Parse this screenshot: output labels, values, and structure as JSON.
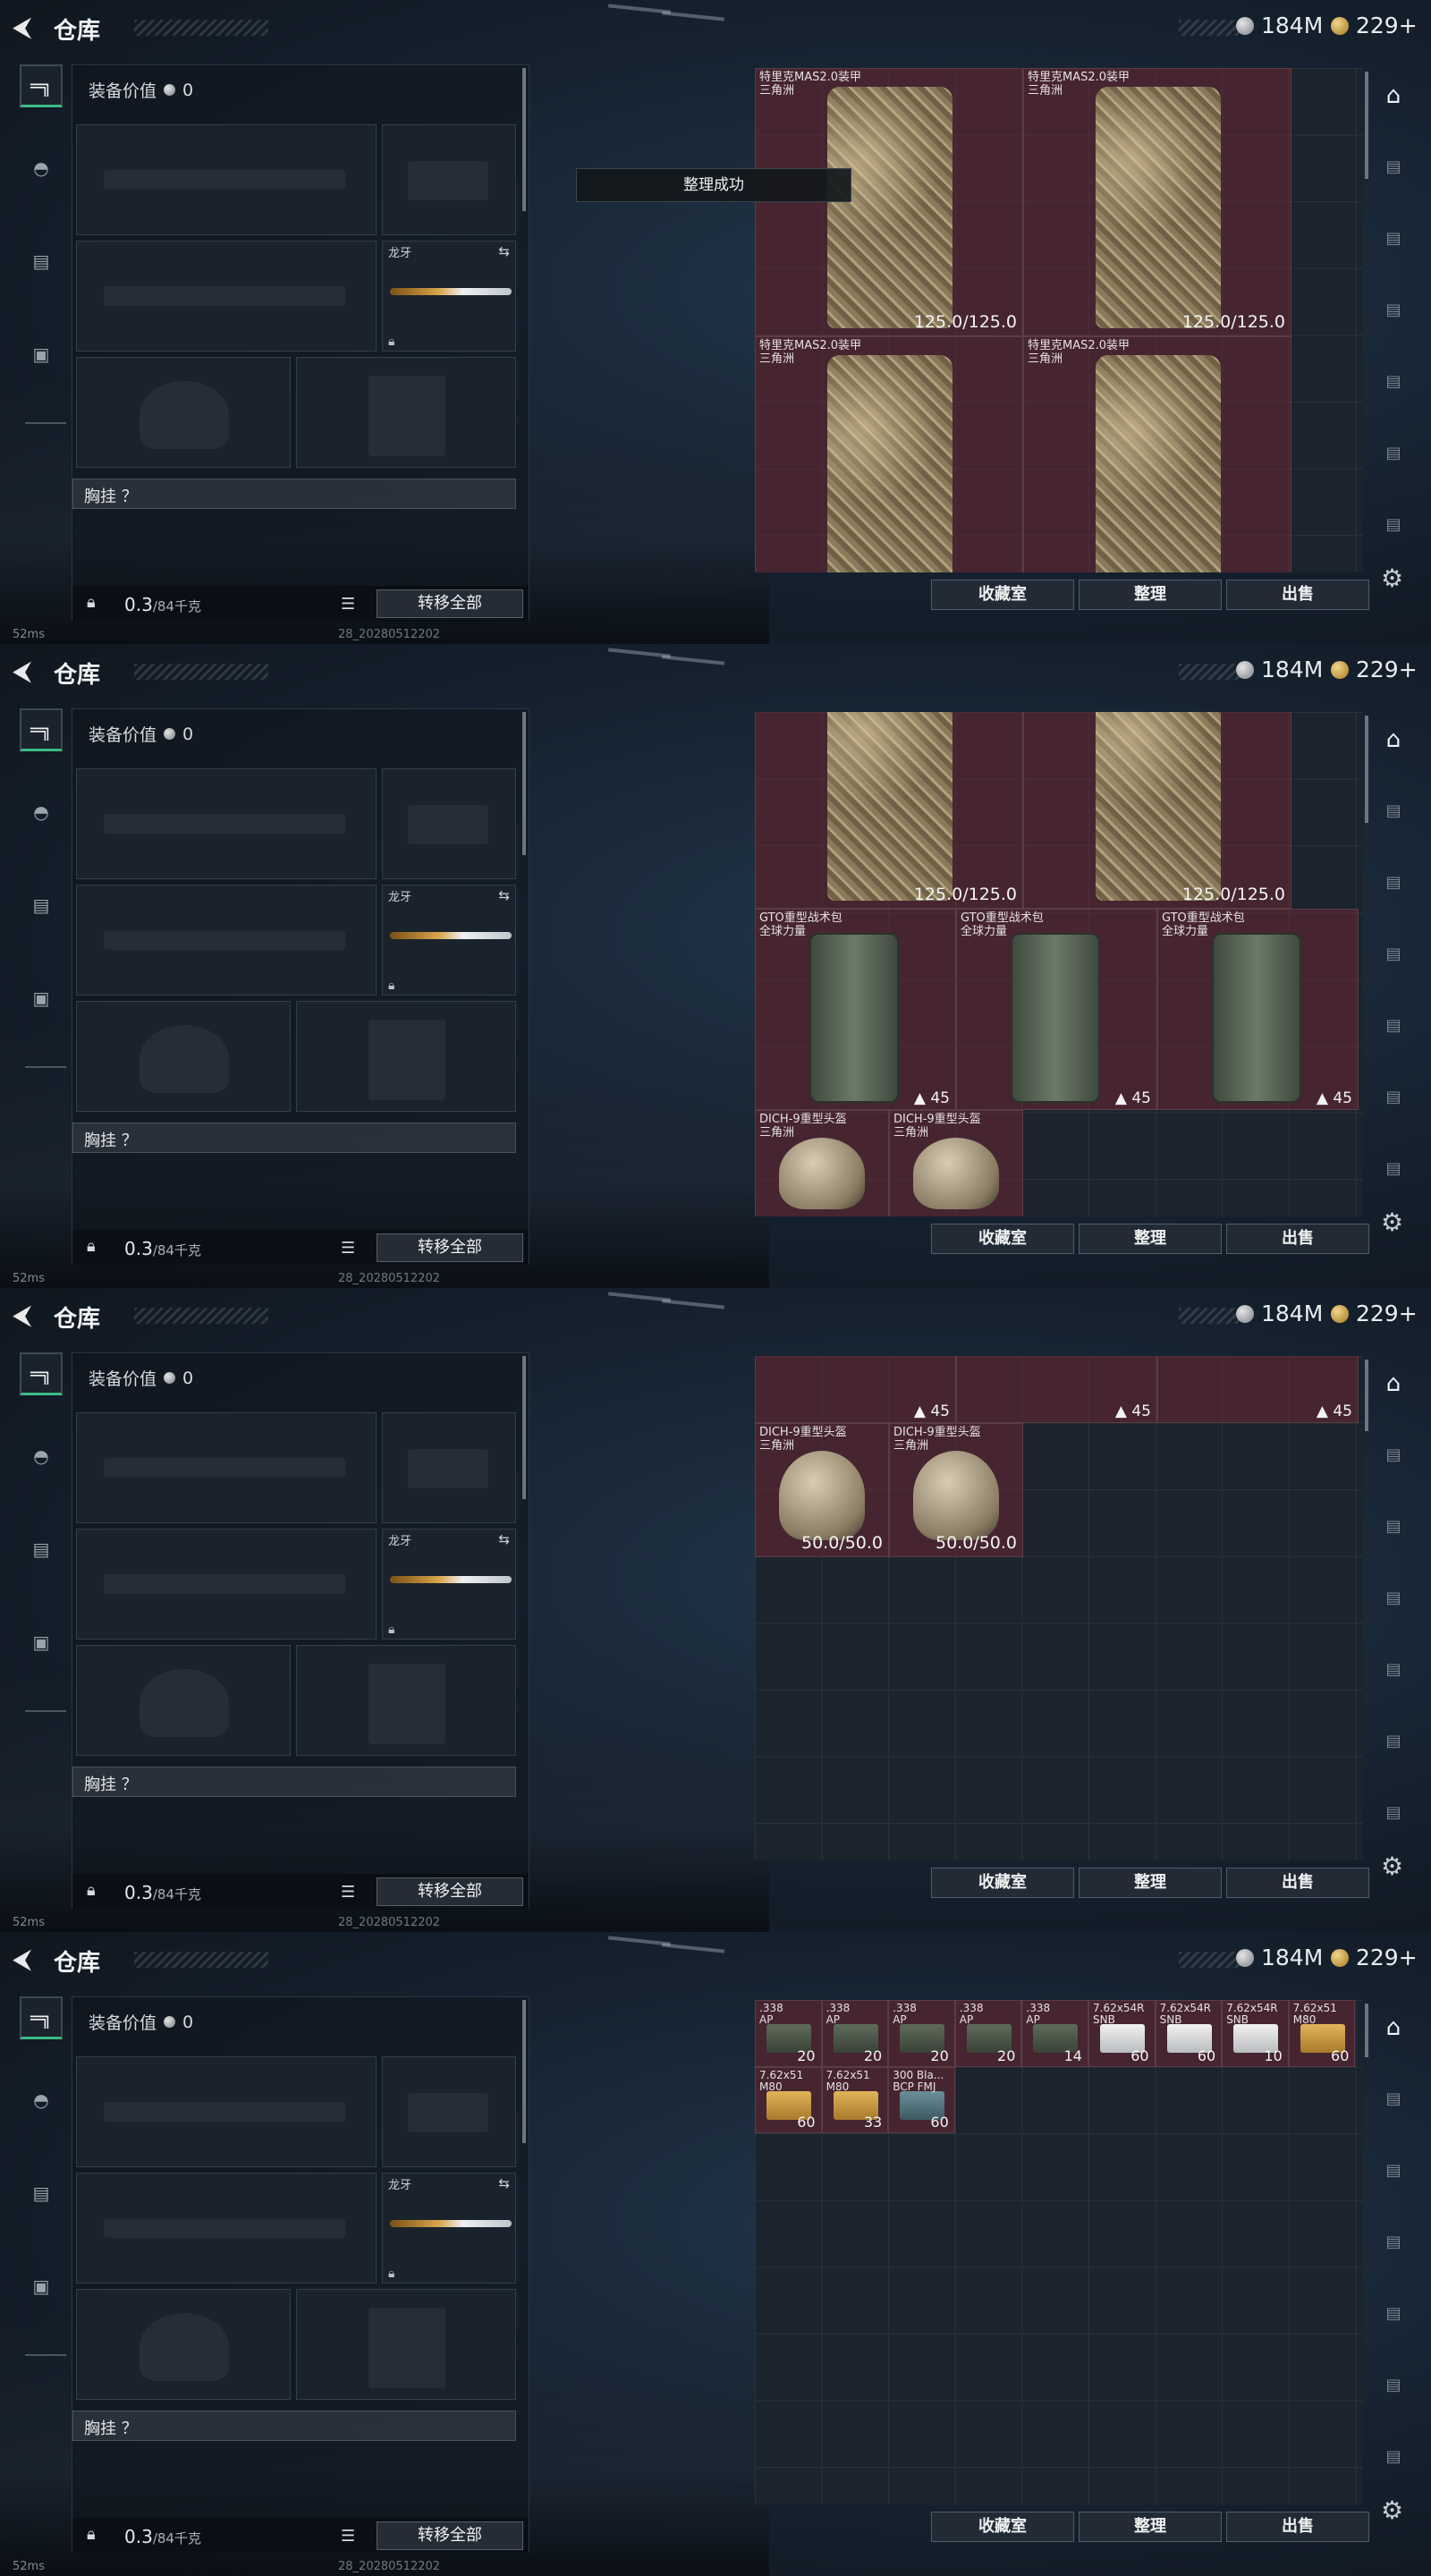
{
  "header": {
    "title": "仓库",
    "silver": "184M",
    "gold": "229+"
  },
  "equipment": {
    "value_label": "装备价值",
    "value": "0",
    "melee_name": "龙牙",
    "chest_rig_label": "胸挂 ？",
    "weight_current": "0.3",
    "weight_max": "/84千克",
    "transfer_all": "转移全部"
  },
  "toast": "整理成功",
  "buttons": {
    "collection": "收藏室",
    "organize": "整理",
    "sell": "出售"
  },
  "status": {
    "ping": "52ms",
    "build": "28_20280512202"
  },
  "icons": [
    "back-arrow-icon",
    "gun-icon",
    "helmet-icon",
    "rig-icon",
    "briefcase-icon",
    "swap-icon",
    "lock-icon",
    "list-icon",
    "storage-icon",
    "gear-icon",
    "silver-coin-icon",
    "gold-coin-icon"
  ],
  "items": {
    "armor_name": "特里克MAS2.0装甲\n三角洲",
    "armor_dur": "125.0/125.0",
    "backpack_name": "GTO重型战术包\n全球力量",
    "backpack_cap": "45",
    "helmet_name": "DICH-9重型头盔\n三角洲",
    "helmet_dur": "50.0/50.0"
  },
  "ammo": [
    {
      "name": ".338\nAP",
      "qty": "20",
      "color": "green"
    },
    {
      "name": ".338\nAP",
      "qty": "20",
      "color": "green"
    },
    {
      "name": ".338\nAP",
      "qty": "20",
      "color": "green"
    },
    {
      "name": ".338\nAP",
      "qty": "20",
      "color": "green"
    },
    {
      "name": ".338\nAP",
      "qty": "14",
      "color": "green"
    },
    {
      "name": "7.62x54R\nSNB",
      "qty": "60",
      "color": "white"
    },
    {
      "name": "7.62x54R\nSNB",
      "qty": "60",
      "color": "white"
    },
    {
      "name": "7.62x54R\nSNB",
      "qty": "10",
      "color": "white"
    },
    {
      "name": "7.62x51\nM80",
      "qty": "60",
      "color": "tan"
    },
    {
      "name": "7.62x51\nM80",
      "qty": "60",
      "color": "tan"
    },
    {
      "name": "7.62x51\nM80",
      "qty": "33",
      "color": "tan"
    },
    {
      "name": "300 Bla...\nBCP FMJ",
      "qty": "60",
      "color": "blue"
    }
  ],
  "colors": {
    "item_bg": "#6a2834",
    "accent_green": "#3dbb85"
  }
}
